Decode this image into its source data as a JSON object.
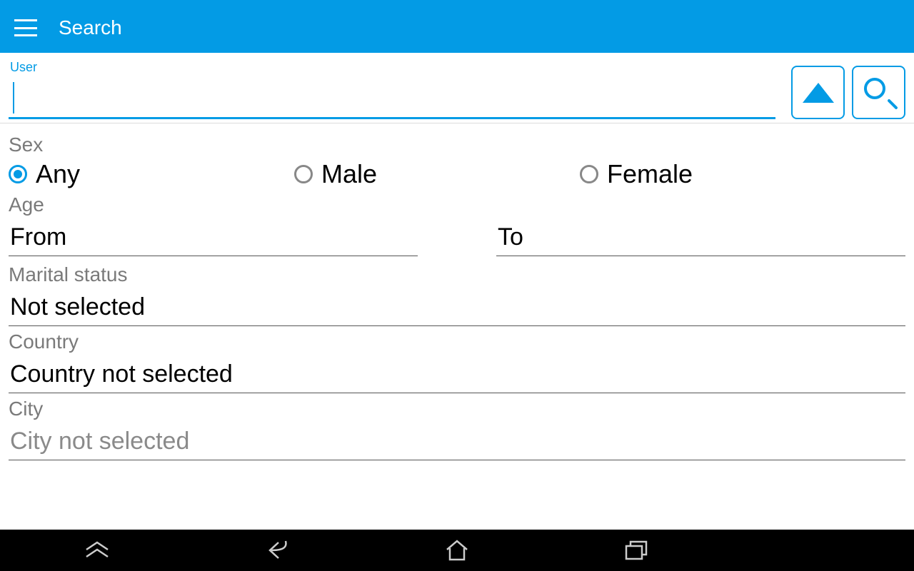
{
  "header": {
    "title": "Search"
  },
  "search": {
    "user_label": "User",
    "user_value": ""
  },
  "form": {
    "sex_label": "Sex",
    "sex_options": {
      "any": "Any",
      "male": "Male",
      "female": "Female"
    },
    "sex_selected": "any",
    "age_label": "Age",
    "age_from_placeholder": "From",
    "age_to_placeholder": "To",
    "marital_label": "Marital status",
    "marital_value": "Not selected",
    "country_label": "Country",
    "country_value": "Country not selected",
    "city_label": "City",
    "city_value": "City not selected"
  }
}
